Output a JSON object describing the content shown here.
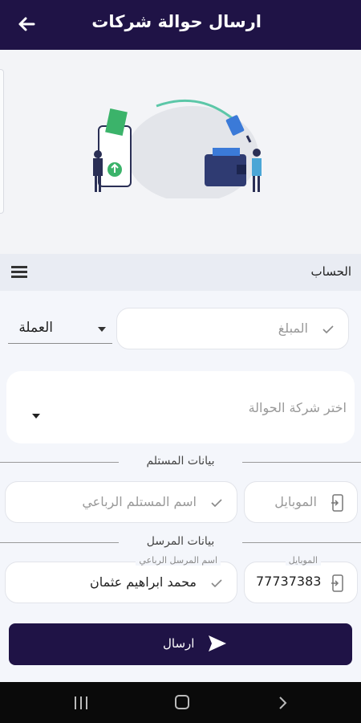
{
  "app": {
    "title": "ارسال حوالة شركات"
  },
  "section": {
    "label": "الحساب"
  },
  "amount": {
    "placeholder": "المبلغ"
  },
  "currency": {
    "label": "العملة"
  },
  "company": {
    "placeholder": "اختر شركة الحوالة"
  },
  "receiver": {
    "section_title": "بيانات المستلم",
    "mobile_placeholder": "الموبايل",
    "name_placeholder": "اسم المستلم الرباعي"
  },
  "sender": {
    "section_title": "بيانات المرسل",
    "mobile_caption": "الموبايل",
    "mobile_value": "77737383",
    "name_caption": "اسم المرسل الرباعي",
    "name_value": "محمد ابراهيم عثمان"
  },
  "actions": {
    "send_label": "ارسال"
  },
  "icons": {
    "back": "arrow-left-icon",
    "menu": "hamburger-menu-icon",
    "check": "check-icon",
    "phone": "phone-icon",
    "send": "send-icon"
  },
  "colors": {
    "primary": "#1f1346",
    "background": "#f4f6fb"
  }
}
